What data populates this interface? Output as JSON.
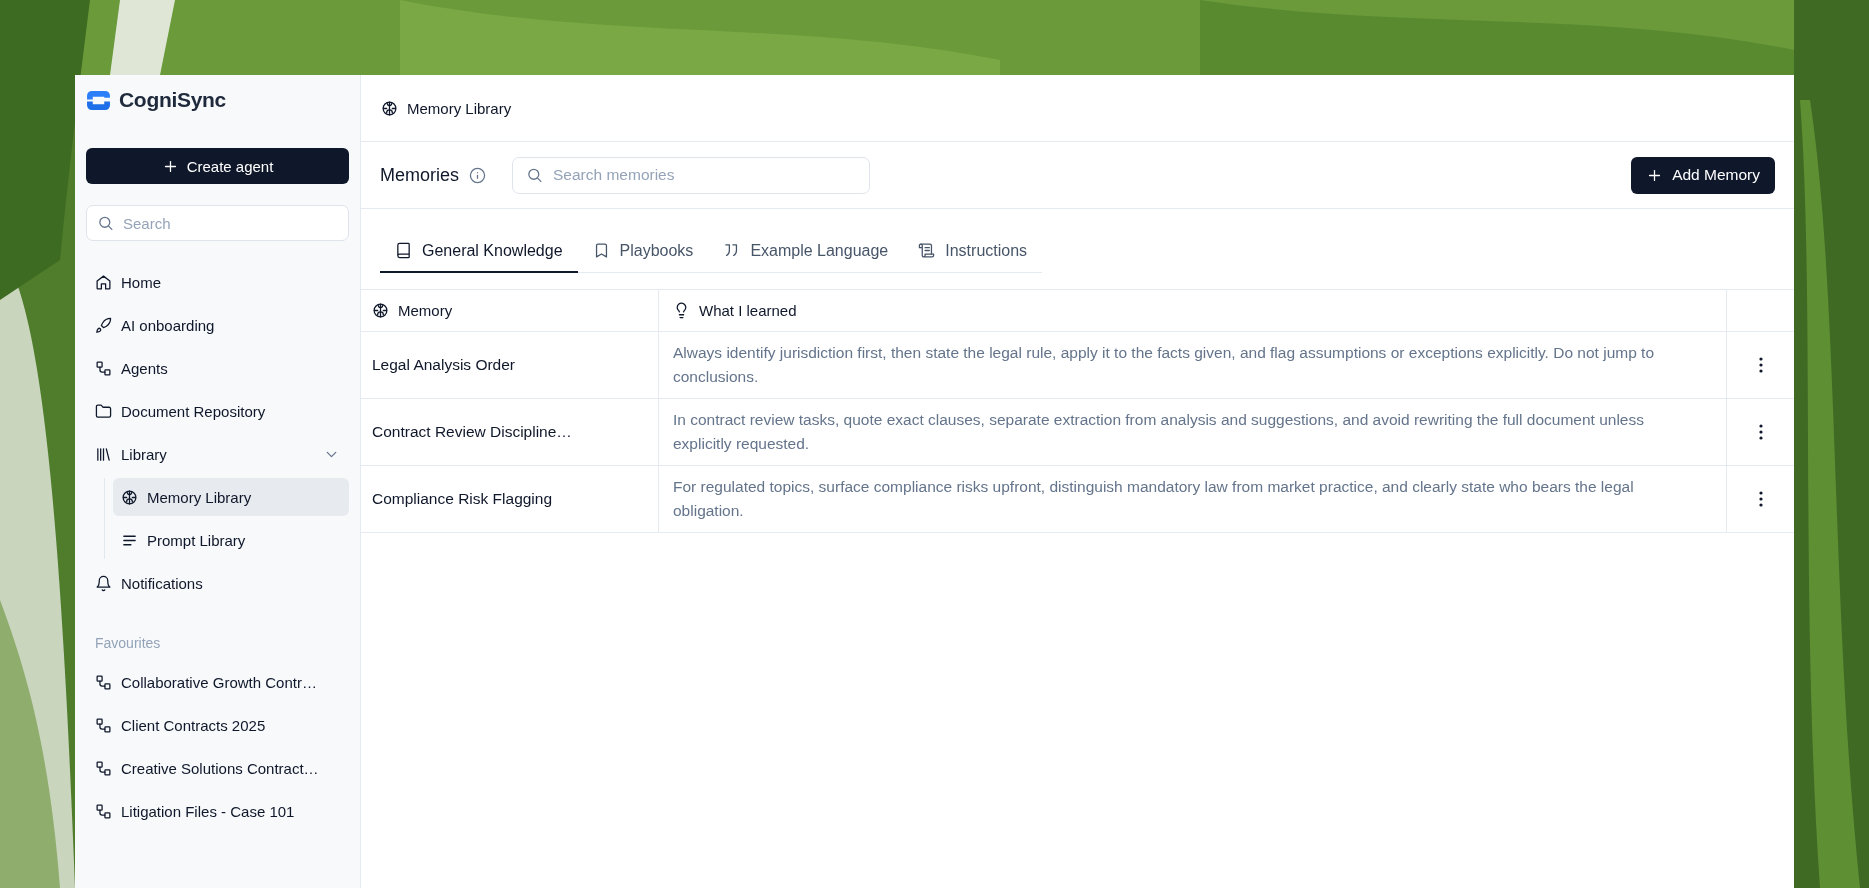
{
  "brand": "CogniSync",
  "create_button": "Create agent",
  "sidebar_search": {
    "placeholder": "Search"
  },
  "nav": [
    {
      "label": "Home",
      "selected": false
    },
    {
      "label": "AI onboarding",
      "selected": false
    },
    {
      "label": "Agents",
      "selected": false
    },
    {
      "label": "Document Repository",
      "selected": false
    },
    {
      "label": "Library",
      "selected": false,
      "expanded": true,
      "children": [
        {
          "label": "Memory Library",
          "selected": true
        },
        {
          "label": "Prompt Library",
          "selected": false
        }
      ]
    },
    {
      "label": "Notifications",
      "selected": false
    }
  ],
  "favourites": {
    "title": "Favourites",
    "items": [
      "Collaborative Growth Contr…",
      "Client Contracts 2025",
      "Creative Solutions Contract…",
      "Litigation Files - Case 101"
    ]
  },
  "breadcrumb": "Memory Library",
  "section": {
    "title": "Memories",
    "search": {
      "placeholder": "Search memories"
    },
    "add_button": "Add Memory"
  },
  "tabs": [
    {
      "label": "General Knowledge",
      "selected": true
    },
    {
      "label": "Playbooks",
      "selected": false
    },
    {
      "label": "Example Language",
      "selected": false
    },
    {
      "label": "Instructions",
      "selected": false
    }
  ],
  "table": {
    "columns": [
      "Memory",
      "What I learned"
    ],
    "rows": [
      {
        "memory": "Legal Analysis Order",
        "learned": "Always identify jurisdiction first, then state the legal rule, apply it to the facts given, and flag assumptions or exceptions explicitly. Do not jump to conclusions."
      },
      {
        "memory": "Contract Review Discipline…",
        "learned": "In contract review tasks, quote exact clauses, separate extraction from analysis and suggestions, and avoid rewriting the full document unless explicitly requested."
      },
      {
        "memory": "Compliance Risk Flagging",
        "learned": "For regulated topics, surface compliance risks upfront, distinguish mandatory law from market practice, and clearly state who bears the legal obligation."
      }
    ]
  }
}
